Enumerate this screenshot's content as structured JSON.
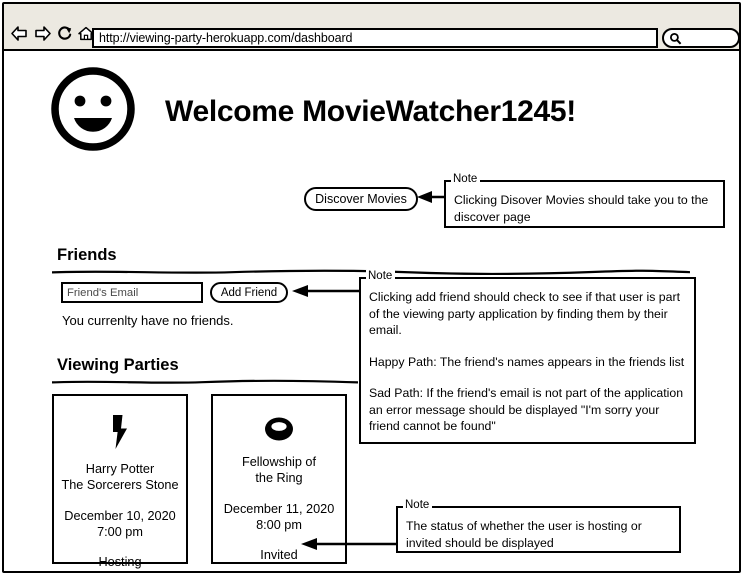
{
  "browser": {
    "url": "http://viewing-party-herokuapp.com/dashboard",
    "search_placeholder": "",
    "icons": {
      "back": "back-arrow-icon",
      "forward": "forward-arrow-icon",
      "reload": "reload-icon",
      "home": "home-icon",
      "search": "search-icon"
    }
  },
  "header": {
    "avatar_icon": "smiley-face-icon",
    "welcome_text": "Welcome MovieWatcher1245!"
  },
  "actions": {
    "discover_movies_label": "Discover Movies",
    "add_friend_label": "Add Friend"
  },
  "friends": {
    "section_title": "Friends",
    "email_placeholder": "Friend's Email",
    "email_value": "",
    "empty_message": "You currenlty have no friends."
  },
  "parties": {
    "section_title": "Viewing Parties",
    "cards": [
      {
        "icon": "lightning-bolt-icon",
        "title": "Harry Potter\nThe Sorcerers Stone",
        "datetime": "December 10, 2020\n7:00 pm",
        "status": "Hosting"
      },
      {
        "icon": "ring-icon",
        "title": "Fellowship of\nthe Ring",
        "datetime": "December 11, 2020\n8:00 pm",
        "status": "Invited"
      }
    ]
  },
  "notes": {
    "label": "Note",
    "discover": "Clicking Disover Movies should take you to the discover page",
    "add_friend_p1": "Clicking add friend should check to see if that user is part of the viewing party application by finding them by their email.",
    "add_friend_p2": "Happy Path: The friend's names appears in the friends list",
    "add_friend_p3": "Sad Path: If the friend's email is not part of the application an error message should be displayed \"I'm sorry your friend cannot be found\"",
    "status": "The status of whether the user is hosting or invited should be displayed"
  },
  "colors": {
    "ink": "#000000",
    "toolbar_bg": "#ece9e1",
    "page_bg": "#ffffff"
  }
}
